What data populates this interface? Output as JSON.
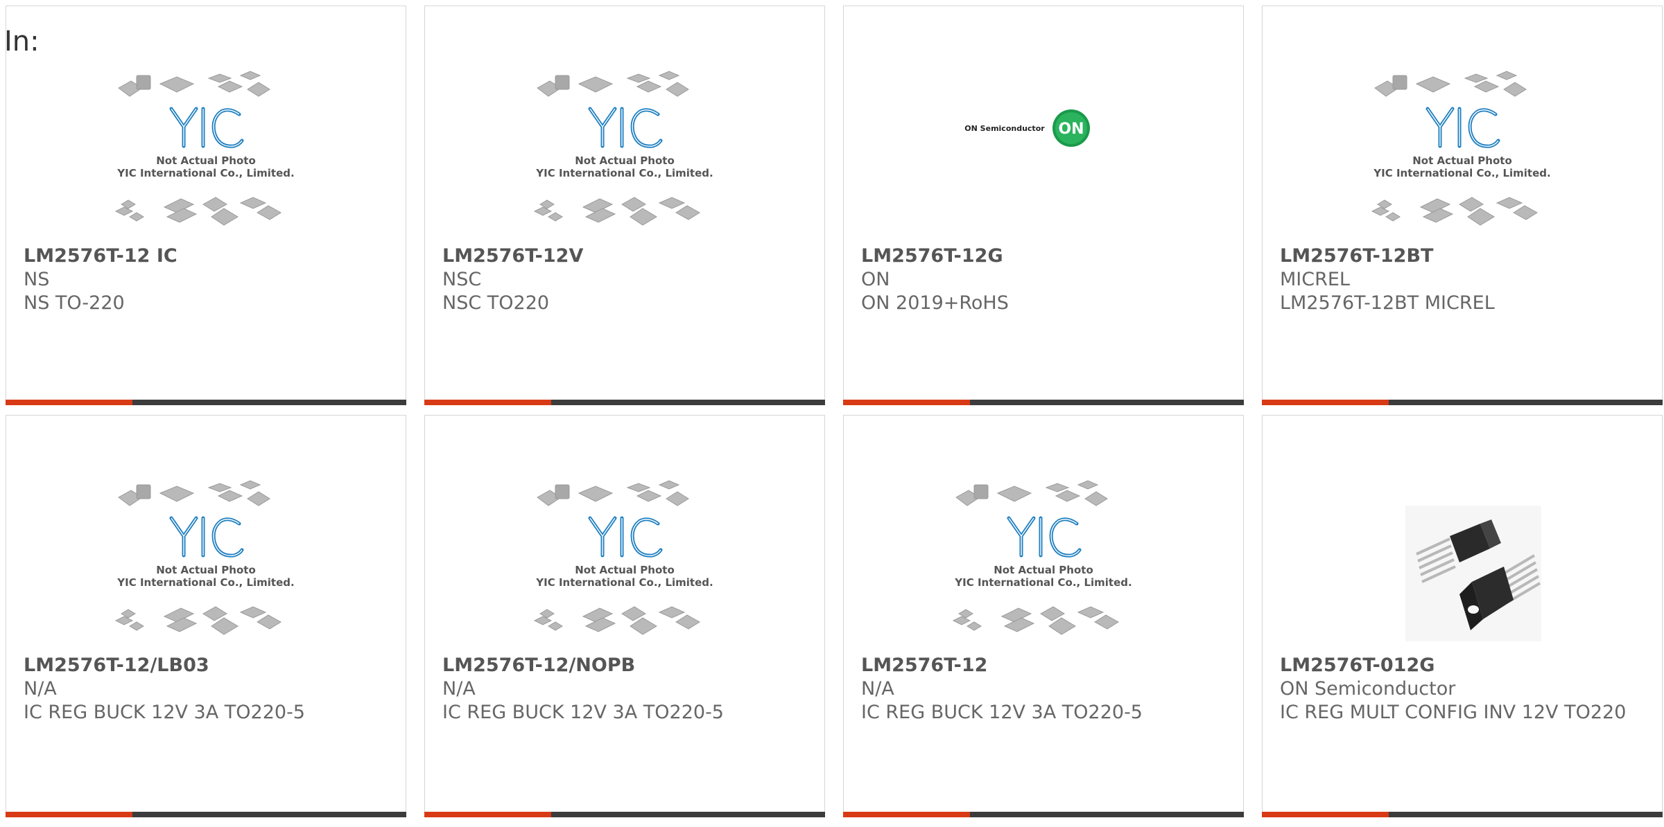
{
  "header": {
    "label": "In:"
  },
  "colors": {
    "accent": "#d83a15",
    "bar": "#3c3c3c",
    "yic_blue": "#1e7fc1"
  },
  "placeholder": {
    "line1": "Not Actual Photo",
    "line2": "YIC International Co., Limited."
  },
  "on_logo": {
    "text": "ON Semiconductor",
    "badge": "ON"
  },
  "products": [
    {
      "part": "LM2576T-12 IC",
      "brand": "NS",
      "desc": "NS TO-220",
      "image": "yic-placeholder"
    },
    {
      "part": "LM2576T-12V",
      "brand": "NSC",
      "desc": "NSC TO220",
      "image": "yic-placeholder"
    },
    {
      "part": "LM2576T-12G",
      "brand": "ON",
      "desc": "ON 2019+RoHS",
      "image": "on-semiconductor-logo"
    },
    {
      "part": "LM2576T-12BT",
      "brand": "MICREL",
      "desc": "LM2576T-12BT MICREL",
      "image": "yic-placeholder"
    },
    {
      "part": "LM2576T-12/LB03",
      "brand": "N/A",
      "desc": "IC REG BUCK 12V 3A TO220-5",
      "image": "yic-placeholder"
    },
    {
      "part": "LM2576T-12/NOPB",
      "brand": "N/A",
      "desc": "IC REG BUCK 12V 3A TO220-5",
      "image": "yic-placeholder"
    },
    {
      "part": "LM2576T-12",
      "brand": "N/A",
      "desc": "IC REG BUCK 12V 3A TO220-5",
      "image": "yic-placeholder"
    },
    {
      "part": "LM2576T-012G",
      "brand": "ON Semiconductor",
      "desc": "IC REG MULT CONFIG INV 12V TO220",
      "image": "to220-package-photo"
    }
  ]
}
